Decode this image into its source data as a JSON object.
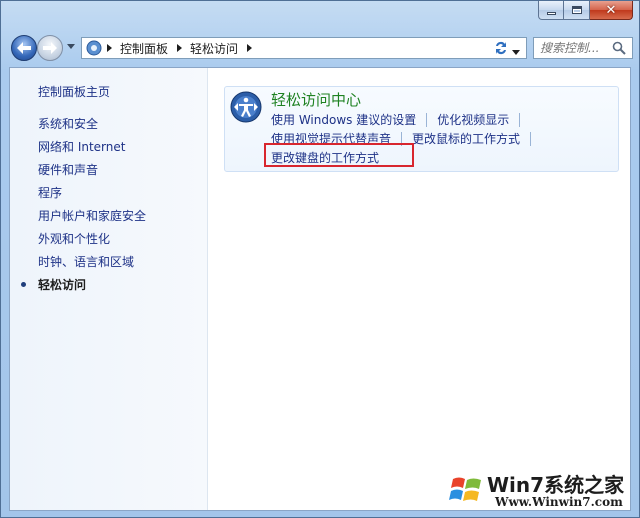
{
  "window": {
    "caption_close": "✕"
  },
  "address": {
    "crumbs": [
      "控制面板",
      "轻松访问"
    ]
  },
  "search": {
    "placeholder": "搜索控制..."
  },
  "sidebar": {
    "home": "控制面板主页",
    "items": [
      {
        "label": "系统和安全",
        "active": false
      },
      {
        "label": "网络和 Internet",
        "active": false
      },
      {
        "label": "硬件和声音",
        "active": false
      },
      {
        "label": "程序",
        "active": false
      },
      {
        "label": "用户帐户和家庭安全",
        "active": false
      },
      {
        "label": "外观和个性化",
        "active": false
      },
      {
        "label": "时钟、语言和区域",
        "active": false
      },
      {
        "label": "轻松访问",
        "active": true
      }
    ]
  },
  "category": {
    "title": "轻松访问中心",
    "links_row1": [
      "使用 Windows 建议的设置",
      "优化视频显示"
    ],
    "links_row2": [
      "使用视觉提示代替声音",
      "更改鼠标的工作方式"
    ],
    "links_row3": [
      "更改键盘的工作方式"
    ],
    "highlight_color": "#d8262e"
  },
  "watermark": {
    "title": "Win7系统之家",
    "url": "Www.Winwin7.com"
  },
  "colors": {
    "link": "#1e3287",
    "category_title": "#1f8222"
  }
}
